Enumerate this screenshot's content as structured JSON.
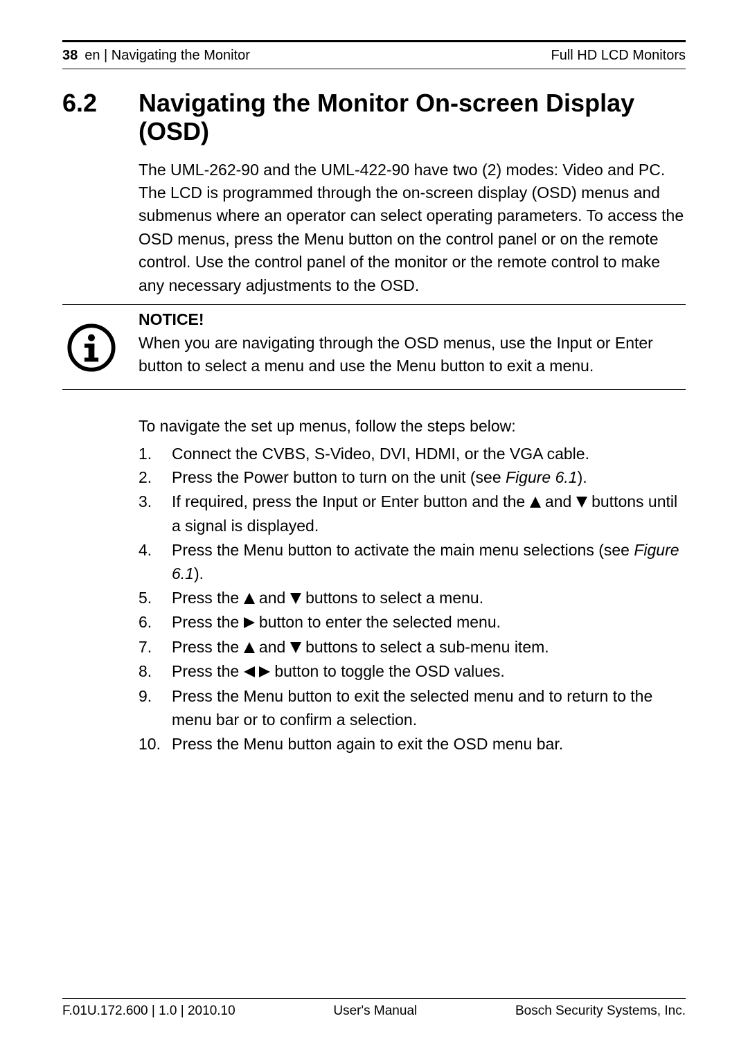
{
  "header": {
    "page_number": "38",
    "breadcrumb": "en | Navigating the Monitor",
    "product": "Full HD LCD Monitors"
  },
  "section": {
    "number": "6.2",
    "title": "Navigating the Monitor On-screen Display (OSD)",
    "intro": "The UML-262-90 and the UML-422-90 have two (2) modes: Video and PC. The LCD is programmed through the on-screen display (OSD) menus and submenus where an operator can select operating parameters. To access the OSD menus, press the Menu button on the control panel or on the remote control. Use the control panel of the monitor or the remote control to make any necessary adjustments to the OSD."
  },
  "notice": {
    "heading": "NOTICE!",
    "body": "When you are navigating through the OSD menus, use the Input or Enter button to select a menu and use the Menu button to exit a menu."
  },
  "steps_intro": "To navigate the set up menus, follow the steps below:",
  "steps": [
    {
      "n": "1.",
      "pre": "Connect the CVBS, S-Video, DVI, HDMI, or the VGA cable."
    },
    {
      "n": "2.",
      "pre": "Press the Power button to turn on the unit (see ",
      "fig": "Figure 6.1",
      "post": ")."
    },
    {
      "n": "3.",
      "pre": "If required, press the Input or Enter button and the ",
      "icons1": "up",
      "mid1": " and ",
      "icons2": "down",
      "post": " buttons until a signal is displayed."
    },
    {
      "n": "4.",
      "pre": "Press the Menu button to activate the main menu selections (see ",
      "fig": "Figure 6.1",
      "post": ")."
    },
    {
      "n": "5.",
      "pre": "Press the ",
      "icons1": "up",
      "mid1": " and ",
      "icons2": "down",
      "post": " buttons to select a menu."
    },
    {
      "n": "6.",
      "pre": "Press the ",
      "icons1": "right",
      "post": " button to enter the selected menu."
    },
    {
      "n": "7.",
      "pre": "Press the ",
      "icons1": "up",
      "mid1": " and ",
      "icons2": "down",
      "post": " buttons to select a sub-menu item."
    },
    {
      "n": "8.",
      "pre": "Press the ",
      "icons1": "leftright",
      "post": " button to toggle the OSD values."
    },
    {
      "n": "9.",
      "pre": "Press the Menu button to exit the selected menu and to return to the menu bar or to confirm a selection."
    },
    {
      "n": "10.",
      "pre": "Press the Menu button again to exit the OSD menu bar."
    }
  ],
  "footer": {
    "left": "F.01U.172.600 | 1.0 | 2010.10",
    "center": "User's Manual",
    "right": "Bosch Security Systems, Inc."
  }
}
